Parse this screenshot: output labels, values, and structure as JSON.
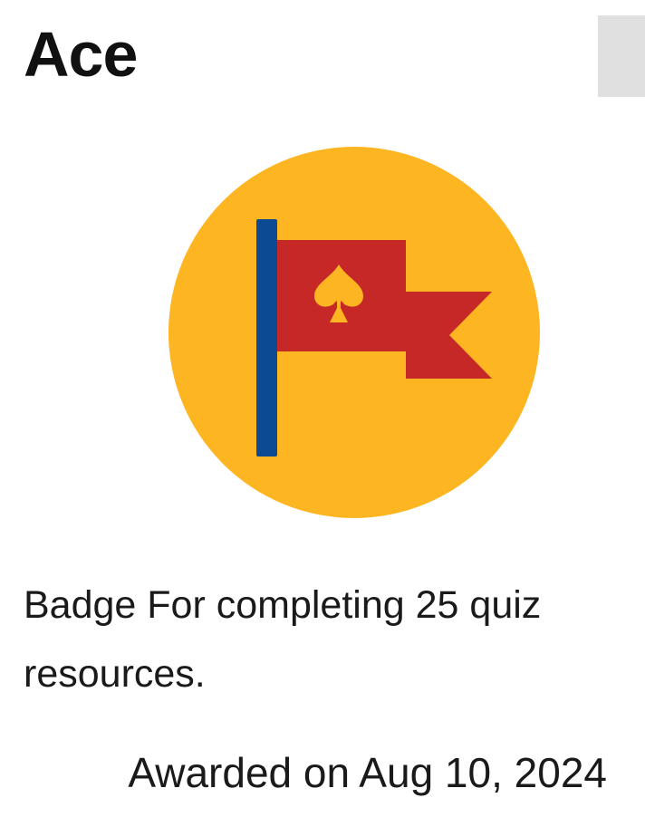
{
  "badge": {
    "title": "Ace",
    "icon": "spade-flag-icon",
    "description": "Badge For completing 25 quiz resources.",
    "awarded": "Awarded on Aug 10, 2024"
  },
  "colors": {
    "circle": "#FDB522",
    "flag": "#C62828",
    "pole": "#0D4A94",
    "scroll_thumb": "#E0E0E0"
  }
}
